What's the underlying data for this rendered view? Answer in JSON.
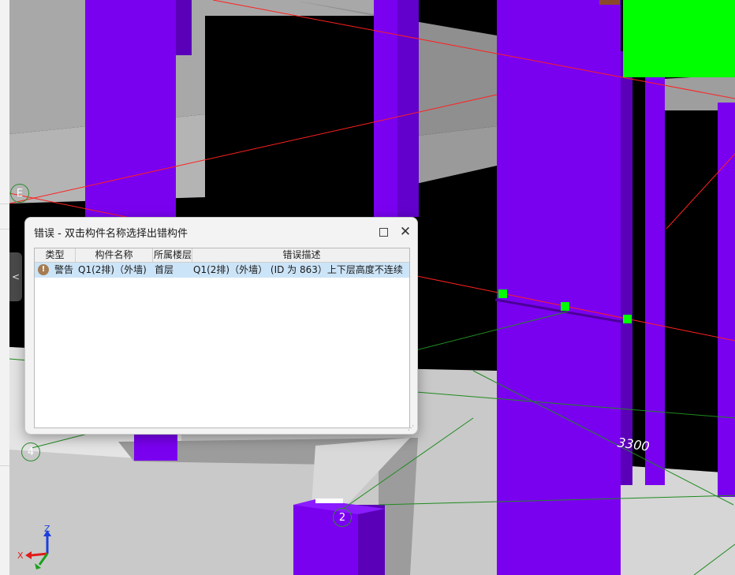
{
  "viewport": {
    "axis_markers": {
      "e": "E",
      "four": "4",
      "two": "2"
    },
    "dimension_label": "3300",
    "triad": {
      "x_label": "X",
      "z_label": "Z"
    }
  },
  "sidebar": {
    "collapse_glyph": "<"
  },
  "error_dialog": {
    "title": "错误 - 双击构件名称选择出错构件",
    "columns": [
      "类型",
      "构件名称",
      "所属楼层",
      "错误描述"
    ],
    "rows": [
      {
        "type": "警告",
        "component_name": "Q1(2排)（外墙)",
        "floor": "首层",
        "description": "Q1(2排)（外墙） (ID 为 863）上下层高度不连续"
      }
    ],
    "icons": {
      "warning": "warning-icon",
      "maximize": "maximize-icon",
      "close": "close-icon"
    }
  },
  "colors": {
    "wall_purple": "#7a00f0",
    "wall_purple_dark": "#5a00b8",
    "slab_gray": "#bdbdbd",
    "highlight_green": "#00ff00",
    "grid_red": "#ff2020",
    "grid_green": "#1f8a1f",
    "row_selected": "#cce4f7"
  }
}
